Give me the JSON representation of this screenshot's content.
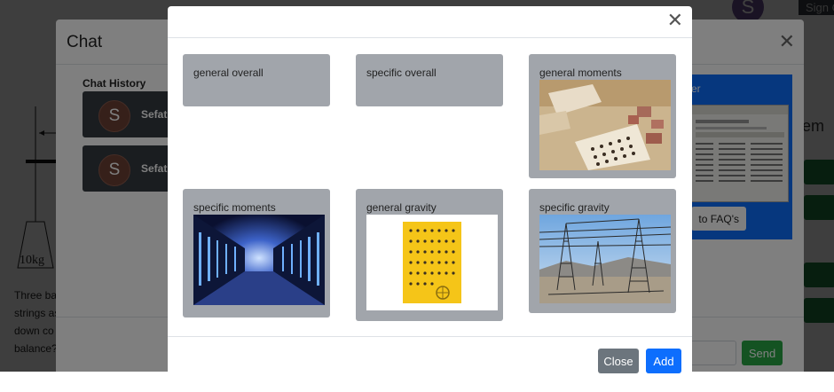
{
  "background": {
    "avatar_initial": "S",
    "signin_text": "Sign O",
    "weight_label": "10kg",
    "question_lines": [
      "Three ba",
      "strings as",
      "down co",
      "balance?"
    ],
    "partial_heading": "em"
  },
  "chat": {
    "title": "Chat",
    "history_label": "Chat History",
    "items": [
      {
        "initial": "S",
        "name": "Sefat"
      },
      {
        "initial": "S",
        "name": "Sefat"
      }
    ],
    "send_label": "Send",
    "help_panel": {
      "title_fragment": "er",
      "faq_button": "to FAQ's",
      "bg_color": "#0d6efd"
    }
  },
  "picker": {
    "close_label": "Close",
    "add_label": "Add",
    "tiles": [
      {
        "label": "general overall",
        "image": null
      },
      {
        "label": "specific overall",
        "image": null
      },
      {
        "label": "general moments",
        "image": "desk-circuit-photo"
      },
      {
        "label": "specific moments",
        "image": "server-room-photo"
      },
      {
        "label": "general gravity",
        "image": "yellow-pcb-photo"
      },
      {
        "label": "specific gravity",
        "image": "power-substation-photo"
      }
    ],
    "colors": {
      "tile_bg": "#a1a5ab",
      "close_btn": "#6c757d",
      "add_btn": "#0d6efd",
      "send_btn": "#28a745"
    }
  }
}
